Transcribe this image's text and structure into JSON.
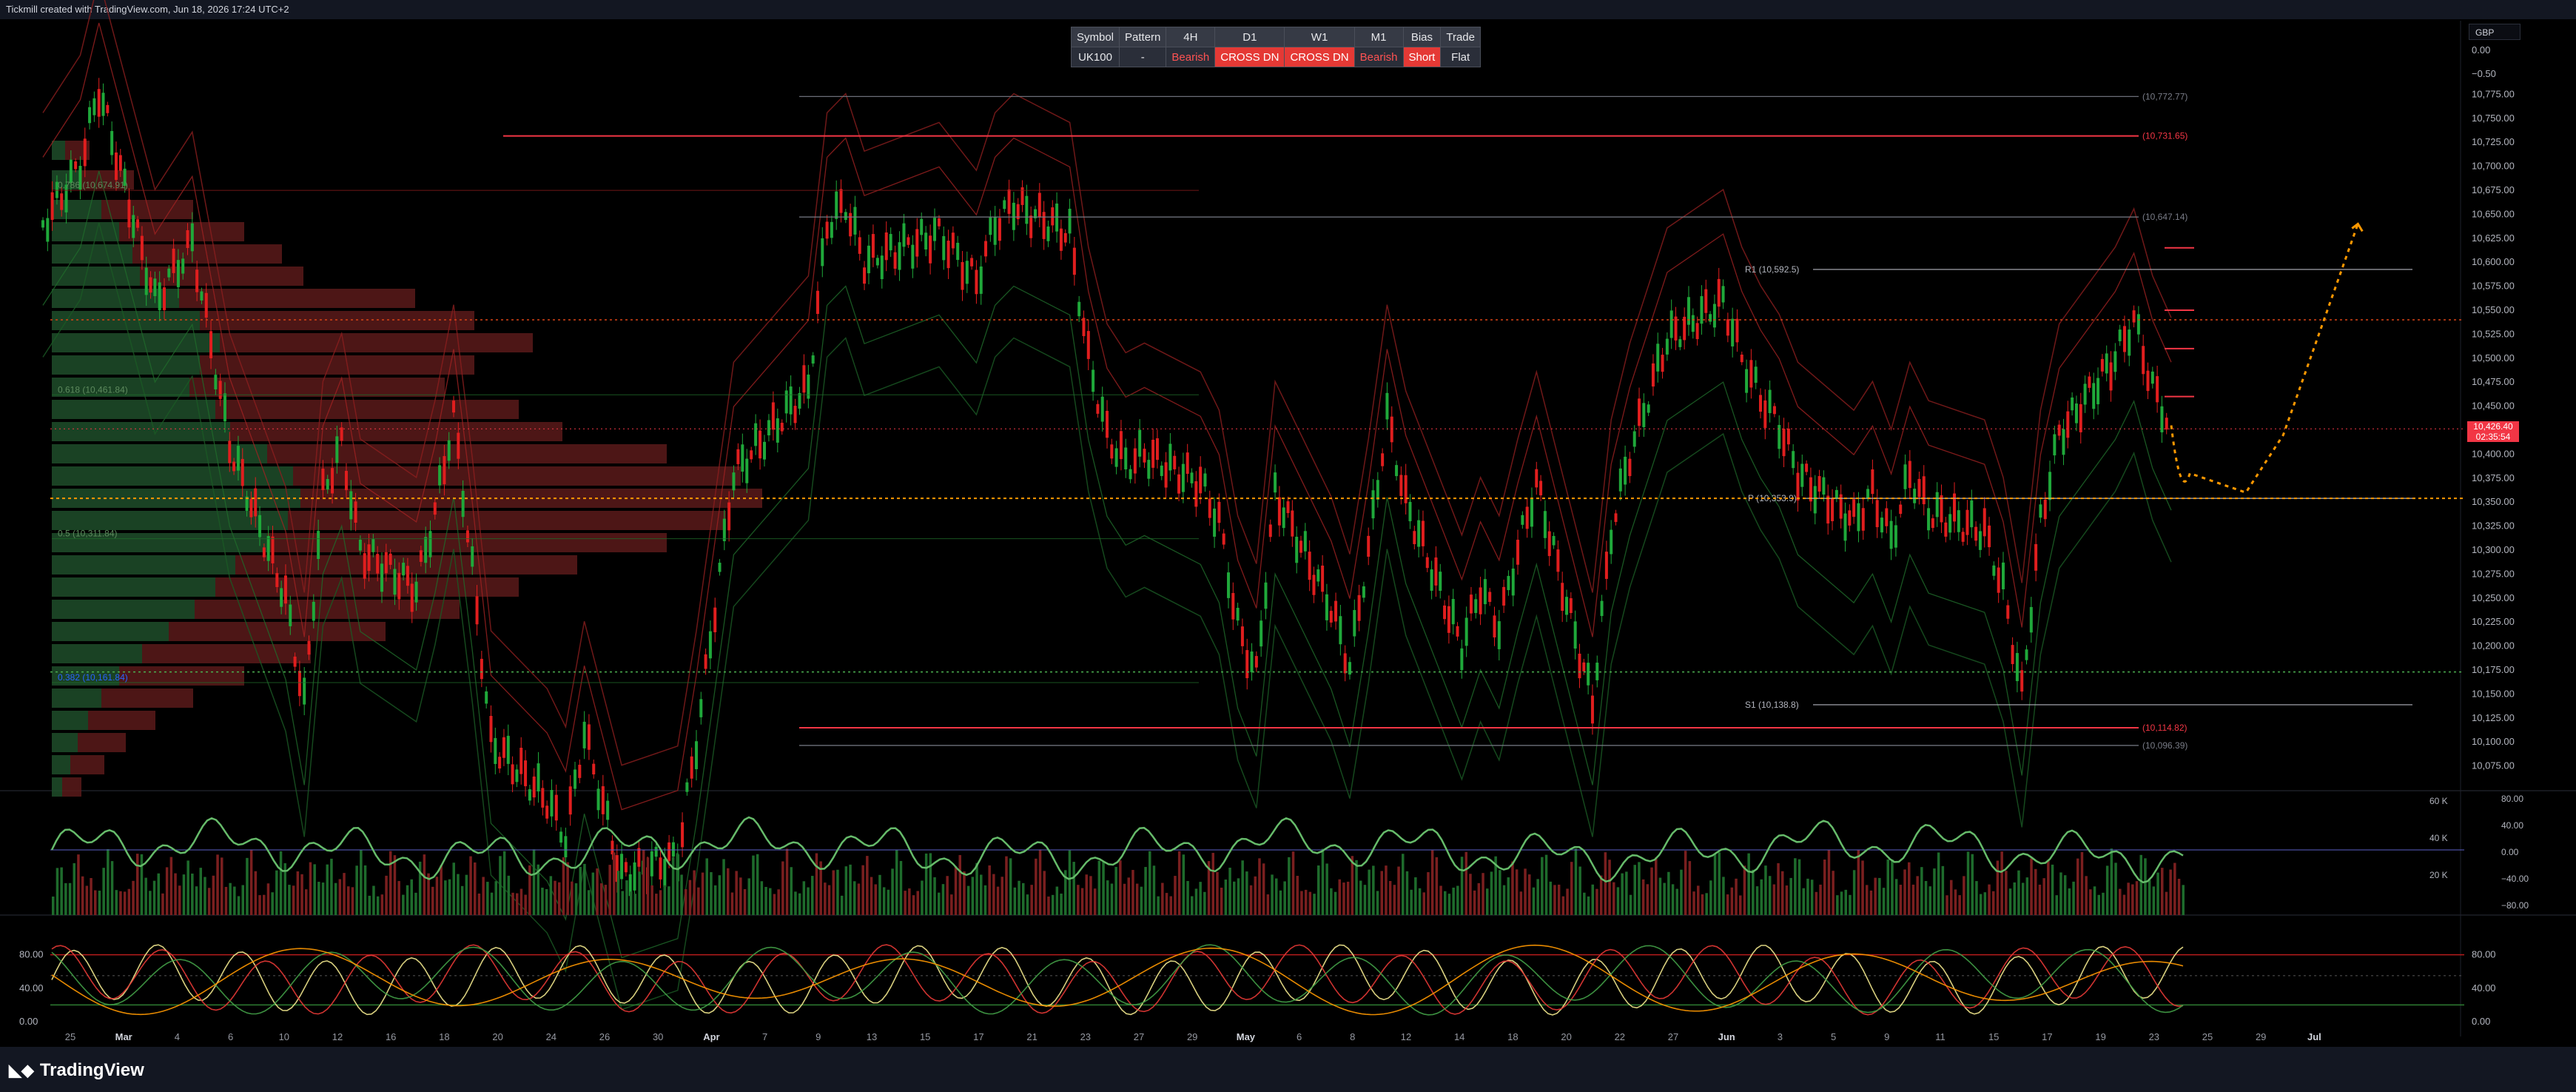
{
  "header": {
    "attribution": "Tickmill created with TradingView.com, Jun 18, 2026 17:24 UTC+2"
  },
  "currency": "GBP",
  "signal_table": {
    "headers": [
      "Symbol",
      "Pattern",
      "4H",
      "D1",
      "W1",
      "M1",
      "Bias",
      "Trade"
    ],
    "values": [
      "UK100",
      "-",
      "Bearish",
      "CROSS DN",
      "CROSS DN",
      "Bearish",
      "Short",
      "Flat"
    ]
  },
  "current_price": {
    "price": "10,426.40",
    "countdown": "02:35:54",
    "color": "#f23645"
  },
  "footer": {
    "brand": "TradingView",
    "logo_icon": "tradingview-logo-icon"
  },
  "colors": {
    "bull": "#26a69a",
    "bear": "#f23645",
    "green_line": "#22c55e",
    "background": "#000000",
    "orange": "#ff9800"
  },
  "chart_data": [
    {
      "type": "line",
      "title": "",
      "symbol": "UK100",
      "timeframe_note": "",
      "ylim": [
        10050,
        10790
      ],
      "y_ticks": [
        "10,775.00",
        "10,750.00",
        "10,725.00",
        "10,700.00",
        "10,675.00",
        "10,650.00",
        "10,625.00",
        "10,600.00",
        "10,575.00",
        "10,550.00",
        "10,525.00",
        "10,500.00",
        "10,475.00",
        "10,450.00",
        "10,425.00",
        "10,400.00",
        "10,375.00",
        "10,350.00",
        "10,325.00",
        "10,300.00",
        "10,275.00",
        "10,250.00",
        "10,225.00",
        "10,200.00",
        "10,175.00",
        "10,150.00",
        "10,125.00",
        "10,100.00",
        "10,075.00"
      ],
      "x_ticks": [
        "25",
        "Mar",
        "4",
        "6",
        "10",
        "12",
        "16",
        "18",
        "20",
        "24",
        "26",
        "30",
        "Apr",
        "7",
        "9",
        "13",
        "15",
        "17",
        "21",
        "23",
        "27",
        "29",
        "May",
        "6",
        "8",
        "12",
        "14",
        "18",
        "20",
        "22",
        "27",
        "Jun",
        "3",
        "5",
        "9",
        "11",
        "15",
        "17",
        "19",
        "23",
        "25",
        "29",
        "Jul"
      ],
      "price_path": [
        {
          "x": "Feb 24",
          "y": 10640
        },
        {
          "x": "Feb 26",
          "y": 10700
        },
        {
          "x": "Feb 27",
          "y": 10780
        },
        {
          "x": "Mar 2",
          "y": 10560
        },
        {
          "x": "Mar 4",
          "y": 10620
        },
        {
          "x": "Mar 6",
          "y": 10410
        },
        {
          "x": "Mar 9",
          "y": 10250
        },
        {
          "x": "Mar 10",
          "y": 10140
        },
        {
          "x": "Mar 11",
          "y": 10360
        },
        {
          "x": "Mar 12",
          "y": 10410
        },
        {
          "x": "Mar 13",
          "y": 10300
        },
        {
          "x": "Mar 16",
          "y": 10260
        },
        {
          "x": "Mar 17",
          "y": 10340
        },
        {
          "x": "Mar 18",
          "y": 10440
        },
        {
          "x": "Mar 19",
          "y": 10280
        },
        {
          "x": "Mar 20",
          "y": 10100
        },
        {
          "x": "Mar 23",
          "y": 10040
        },
        {
          "x": "Mar 24",
          "y": 10000
        },
        {
          "x": "Mar 25",
          "y": 10110
        },
        {
          "x": "Mar 27",
          "y": 9960
        },
        {
          "x": "Mar 30",
          "y": 9980
        },
        {
          "x": "Mar 31",
          "y": 10100
        },
        {
          "x": "Apr 1",
          "y": 10240
        },
        {
          "x": "Apr 2",
          "y": 10380
        },
        {
          "x": "Apr 6",
          "y": 10470
        },
        {
          "x": "Apr 7",
          "y": 10640
        },
        {
          "x": "Apr 8",
          "y": 10660
        },
        {
          "x": "Apr 9",
          "y": 10600
        },
        {
          "x": "Apr 13",
          "y": 10630
        },
        {
          "x": "Apr 15",
          "y": 10580
        },
        {
          "x": "Apr 16",
          "y": 10640
        },
        {
          "x": "Apr 17",
          "y": 10660
        },
        {
          "x": "Apr 20",
          "y": 10630
        },
        {
          "x": "Apr 21",
          "y": 10500
        },
        {
          "x": "Apr 22",
          "y": 10420
        },
        {
          "x": "Apr 23",
          "y": 10390
        },
        {
          "x": "Apr 24",
          "y": 10400
        },
        {
          "x": "Apr 27",
          "y": 10370
        },
        {
          "x": "Apr 28",
          "y": 10330
        },
        {
          "x": "Apr 29",
          "y": 10220
        },
        {
          "x": "Apr 30",
          "y": 10170
        },
        {
          "x": "May 1",
          "y": 10360
        },
        {
          "x": "May 4",
          "y": 10240
        },
        {
          "x": "May 5",
          "y": 10180
        },
        {
          "x": "May 6",
          "y": 10300
        },
        {
          "x": "May 7",
          "y": 10440
        },
        {
          "x": "May 8",
          "y": 10350
        },
        {
          "x": "May 11",
          "y": 10200
        },
        {
          "x": "May 12",
          "y": 10260
        },
        {
          "x": "May 13",
          "y": 10220
        },
        {
          "x": "May 14",
          "y": 10300
        },
        {
          "x": "May 15",
          "y": 10370
        },
        {
          "x": "May 18",
          "y": 10140
        },
        {
          "x": "May 19",
          "y": 10320
        },
        {
          "x": "May 20",
          "y": 10400
        },
        {
          "x": "May 21",
          "y": 10460
        },
        {
          "x": "May 22",
          "y": 10520
        },
        {
          "x": "May 25",
          "y": 10560
        },
        {
          "x": "May 26",
          "y": 10500
        },
        {
          "x": "May 27",
          "y": 10460
        },
        {
          "x": "May 28",
          "y": 10430
        },
        {
          "x": "May 29",
          "y": 10380
        },
        {
          "x": "Jun 1",
          "y": 10330
        },
        {
          "x": "Jun 2",
          "y": 10360
        },
        {
          "x": "Jun 3",
          "y": 10310
        },
        {
          "x": "Jun 4",
          "y": 10380
        },
        {
          "x": "Jun 5",
          "y": 10340
        },
        {
          "x": "Jun 8",
          "y": 10320
        },
        {
          "x": "Jun 9",
          "y": 10260
        },
        {
          "x": "Jun 10",
          "y": 10150
        },
        {
          "x": "Jun 11",
          "y": 10330
        },
        {
          "x": "Jun 12",
          "y": 10420
        },
        {
          "x": "Jun 15",
          "y": 10500
        },
        {
          "x": "Jun 16",
          "y": 10540
        },
        {
          "x": "Jun 17",
          "y": 10470
        },
        {
          "x": "Jun 18",
          "y": 10426.4
        }
      ],
      "forecast_path": [
        {
          "x": "Jun 18",
          "y": 10430
        },
        {
          "x": "Jun 19",
          "y": 10380
        },
        {
          "x": "Jun 22",
          "y": 10360
        },
        {
          "x": "Jun 24",
          "y": 10420
        },
        {
          "x": "Jun 26",
          "y": 10530
        },
        {
          "x": "Jun 28",
          "y": 10640
        }
      ],
      "levels": [
        {
          "label": "(10,772.77)",
          "value": 10772.77,
          "color": "#787b86"
        },
        {
          "label": "(10,731.65)",
          "value": 10731.65,
          "color": "#f23645"
        },
        {
          "label": "(10,647.14)",
          "value": 10647.14,
          "color": "#787b86"
        },
        {
          "label": "R1 (10,592.5)",
          "value": 10592.5,
          "color": "#b2b5be"
        },
        {
          "label": "P (10,353.9)",
          "value": 10353.9,
          "color": "#b2b5be"
        },
        {
          "label": "S1 (10,138.8)",
          "value": 10138.8,
          "color": "#b2b5be"
        },
        {
          "label": "(10,114.82)",
          "value": 10114.82,
          "color": "#f23645"
        },
        {
          "label": "(10,096.39)",
          "value": 10096.39,
          "color": "#787b86"
        }
      ],
      "fib_labels": [
        {
          "label": "0.786 (10,674.91)",
          "value": 10674.91
        },
        {
          "label": "0.618 (10,461.84)",
          "value": 10461.84
        },
        {
          "label": "0.5 (10,311.84)",
          "value": 10311.84
        },
        {
          "label": "0.382 (10,161.84)",
          "value": 10161.84
        }
      ],
      "orange_level": 10353.9,
      "green_level": 10461.84,
      "green_dotted_level": 10173
    },
    {
      "type": "bar",
      "title": "",
      "y_ticks_left": [
        "60 K",
        "40 K",
        "20 K"
      ],
      "y_ticks_right": [
        "80.00",
        "40.00",
        "0.00",
        "−40.00",
        "−80.00"
      ]
    },
    {
      "type": "line",
      "title": "",
      "y_ticks_left": [
        "80.00",
        "40.00",
        "0.00"
      ],
      "y_ticks_right": [
        "80.00",
        "40.00",
        "0.00"
      ],
      "bands": [
        80,
        40,
        20
      ]
    }
  ]
}
